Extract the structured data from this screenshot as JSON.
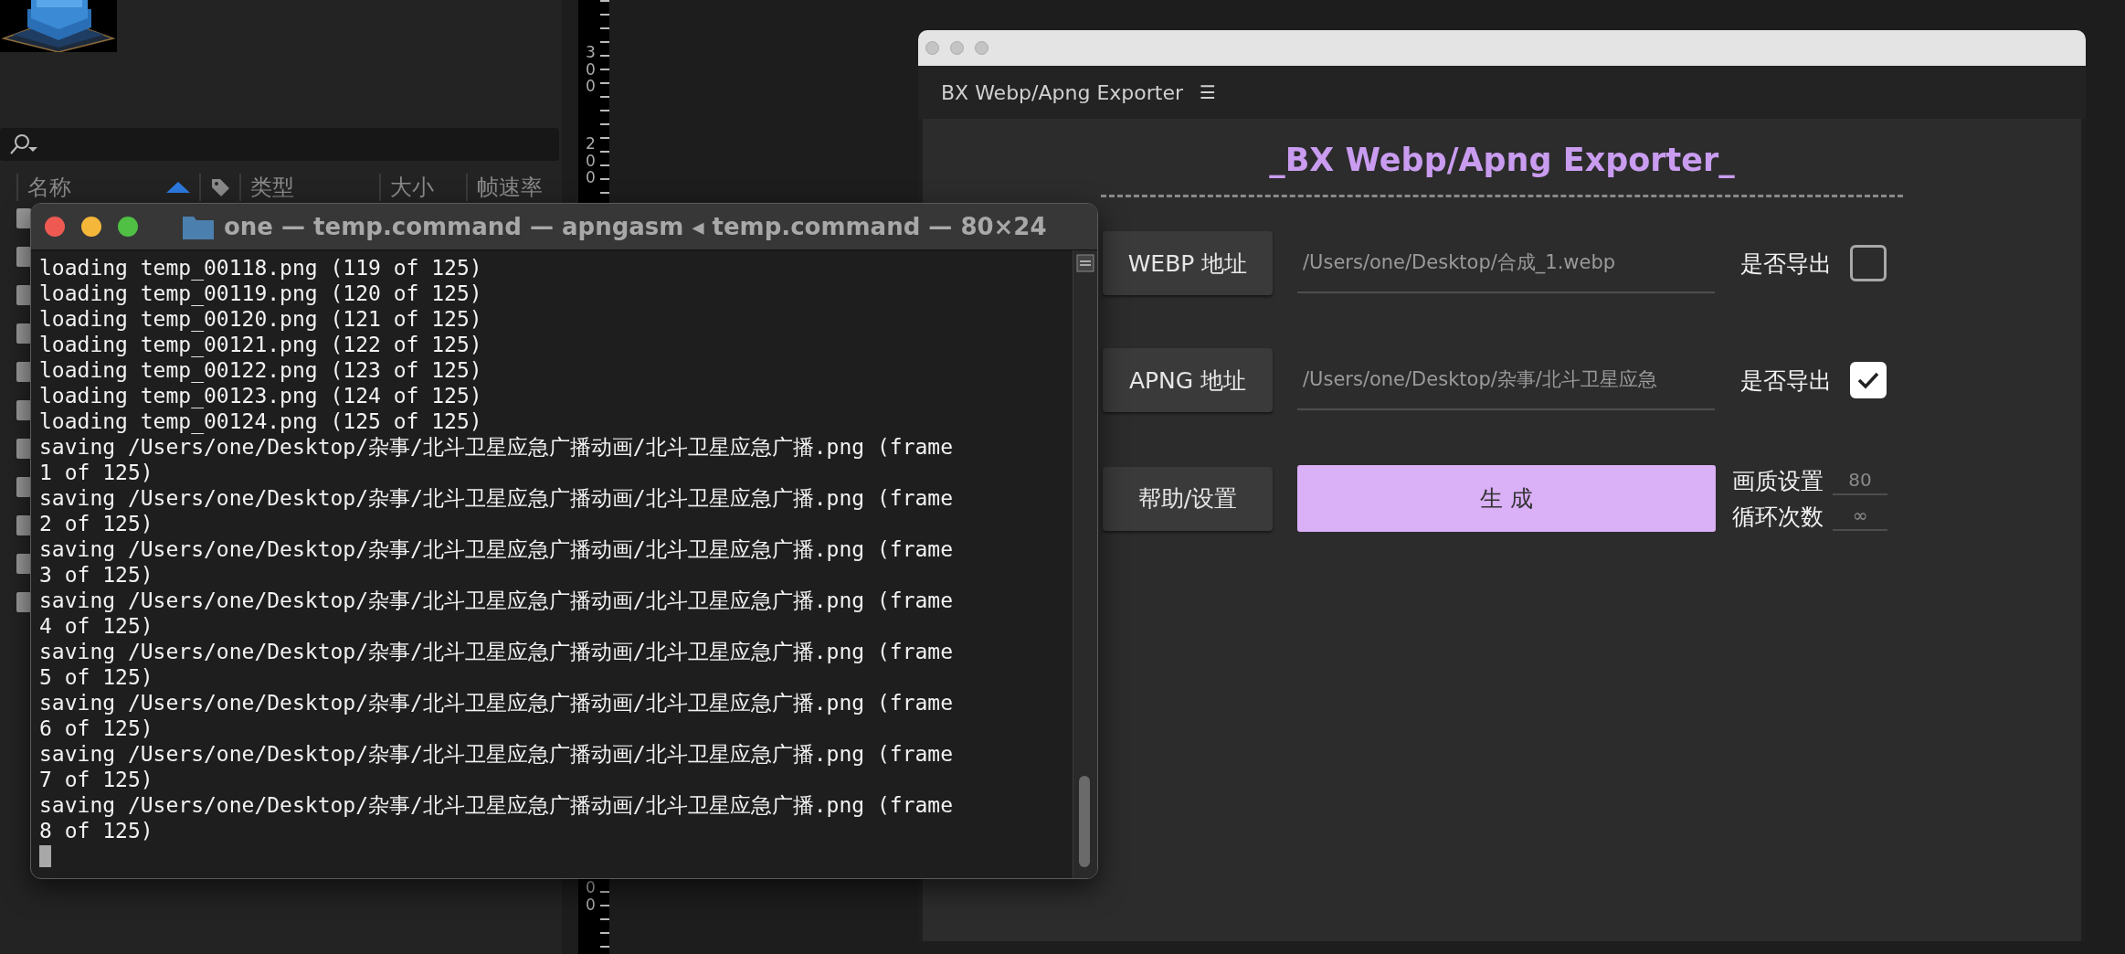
{
  "project_panel": {
    "columns": [
      {
        "kind": "text",
        "label": "名称",
        "sorted": true
      },
      {
        "kind": "tag",
        "sorted": false
      },
      {
        "kind": "text",
        "label": "类型",
        "sorted": false
      },
      {
        "kind": "text",
        "label": "大小",
        "sorted": false
      },
      {
        "kind": "text",
        "label": "帧速率",
        "sorted": false
      }
    ]
  },
  "ruler": {
    "labels": [
      "300",
      "200",
      "00"
    ]
  },
  "terminal": {
    "title": "one — temp.command — apngasm ◂ temp.command — 80×24",
    "lines": [
      "loading temp_00118.png (119 of 125)",
      "loading temp_00119.png (120 of 125)",
      "loading temp_00120.png (121 of 125)",
      "loading temp_00121.png (122 of 125)",
      "loading temp_00122.png (123 of 125)",
      "loading temp_00123.png (124 of 125)",
      "loading temp_00124.png (125 of 125)",
      "saving /Users/one/Desktop/杂事/北斗卫星应急广播动画/北斗卫星应急广播.png (frame",
      "1 of 125)",
      "saving /Users/one/Desktop/杂事/北斗卫星应急广播动画/北斗卫星应急广播.png (frame",
      "2 of 125)",
      "saving /Users/one/Desktop/杂事/北斗卫星应急广播动画/北斗卫星应急广播.png (frame",
      "3 of 125)",
      "saving /Users/one/Desktop/杂事/北斗卫星应急广播动画/北斗卫星应急广播.png (frame",
      "4 of 125)",
      "saving /Users/one/Desktop/杂事/北斗卫星应急广播动画/北斗卫星应急广播.png (frame",
      "5 of 125)",
      "saving /Users/one/Desktop/杂事/北斗卫星应急广播动画/北斗卫星应急广播.png (frame",
      "6 of 125)",
      "saving /Users/one/Desktop/杂事/北斗卫星应急广播动画/北斗卫星应急广播.png (frame",
      "7 of 125)",
      "saving /Users/one/Desktop/杂事/北斗卫星应急广播动画/北斗卫星应急广播.png (frame",
      "8 of 125)"
    ]
  },
  "plugin": {
    "tab_title": "BX Webp/Apng Exporter",
    "menu_glyph": "☰",
    "heading": "_BX Webp/Apng Exporter_",
    "rows": [
      {
        "button": "WEBP 地址",
        "value": "/Users/one/Desktop/合成_1.webp",
        "check_label": "是否导出",
        "checked": false
      },
      {
        "button": "APNG 地址",
        "value": "/Users/one/Desktop/杂事/北斗卫星应急",
        "check_label": "是否导出",
        "checked": true
      }
    ],
    "help_button": "帮助/设置",
    "generate_button": "生 成",
    "settings": [
      {
        "label": "画质设置",
        "value": "80"
      },
      {
        "label": "循环次数",
        "value": "∞"
      }
    ]
  }
}
